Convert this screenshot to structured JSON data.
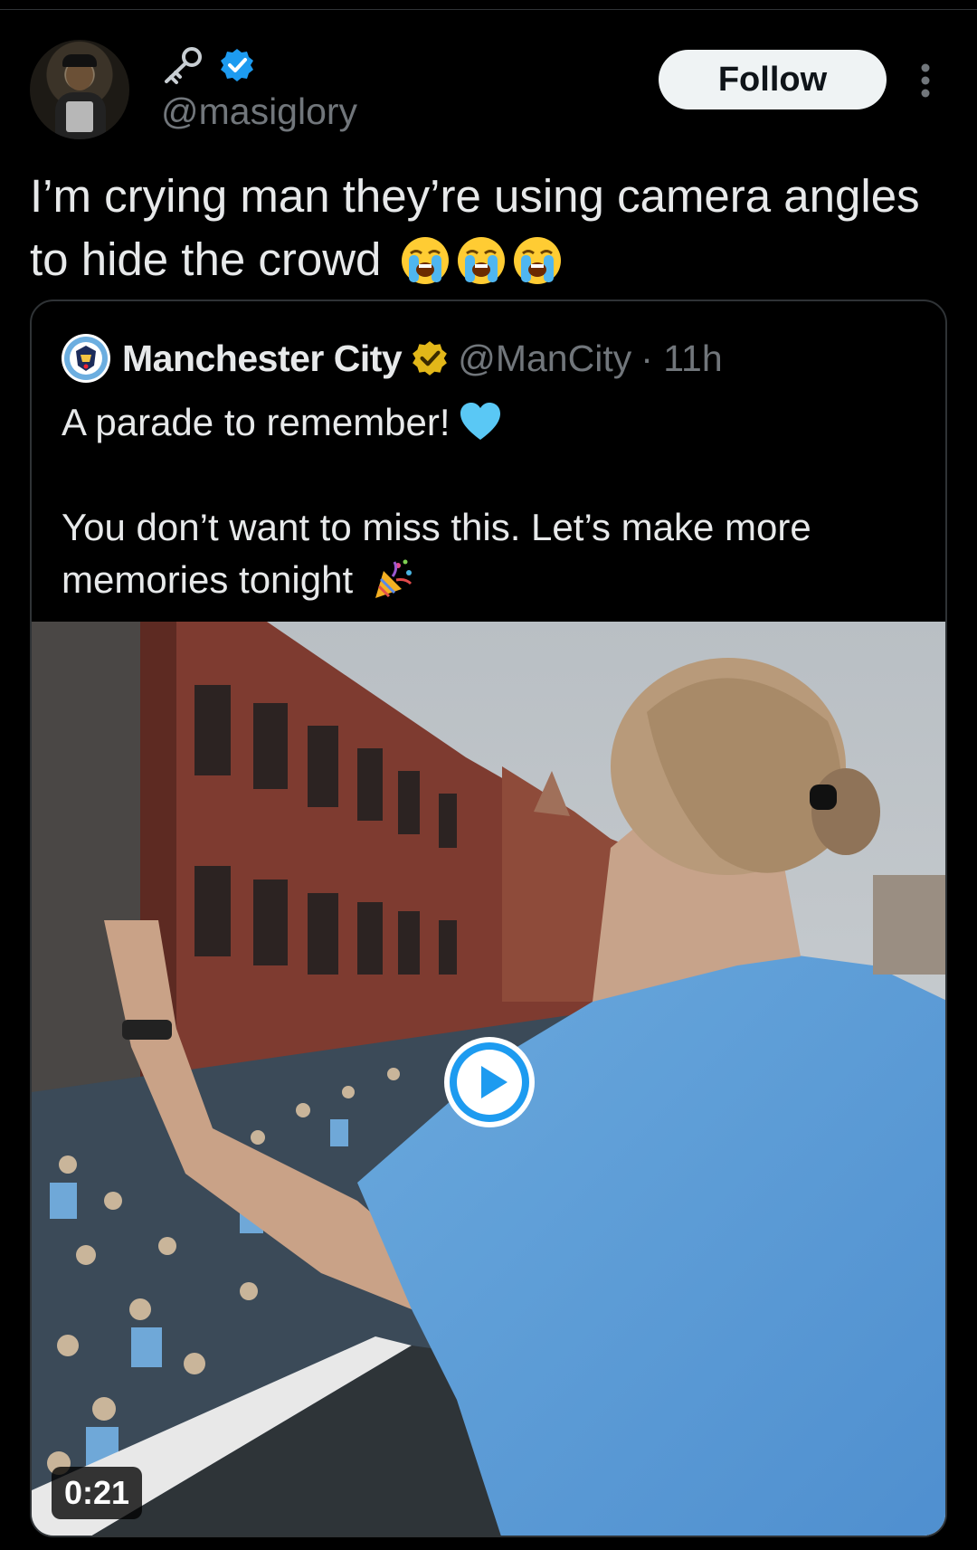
{
  "post": {
    "author": {
      "handle": "@masiglory",
      "display_icon": "key-icon",
      "verified": true,
      "verified_color": "#1d9bf0"
    },
    "follow_label": "Follow",
    "more_icon": "more-vertical-icon",
    "text": "I’m crying man they’re using camera angles to hide the crowd",
    "emojis": [
      "loudly-crying-face",
      "loudly-crying-face",
      "loudly-crying-face"
    ]
  },
  "quoted": {
    "name": "Manchester City",
    "verified_color": "#e2b719",
    "handle": "@ManCity",
    "time": "· 11h",
    "text": "A parade to remember!",
    "text_emoji": "light-blue-heart",
    "text2": "You don’t want to miss this. Let’s make more\nmemories tonight",
    "text2_emoji": "party-popper",
    "video": {
      "duration": "0:21",
      "play_icon": "play-icon"
    }
  },
  "colors": {
    "background": "#000000",
    "text": "#e7e9ea",
    "muted": "#71767b",
    "border": "#2f3336",
    "accent": "#1d9bf0"
  }
}
